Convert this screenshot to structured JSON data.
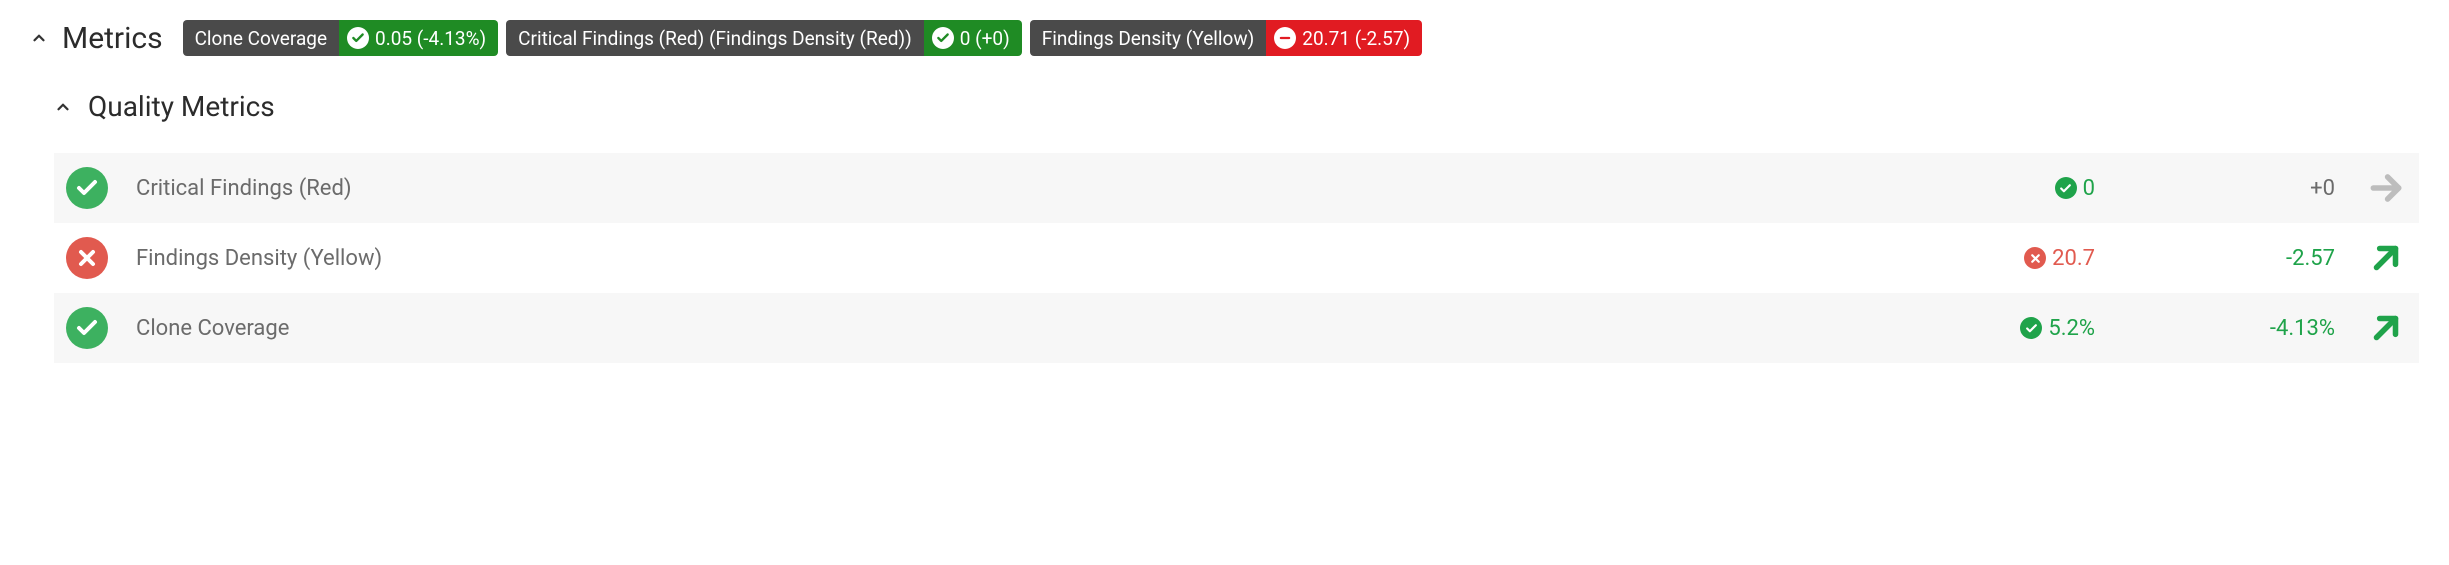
{
  "header": {
    "title": "Metrics"
  },
  "badges": [
    {
      "label": "Clone Coverage",
      "status": "ok",
      "color": "green",
      "value_text": "0.05 (-4.13%)"
    },
    {
      "label": "Critical Findings (Red) (Findings Density (Red))",
      "status": "ok",
      "color": "green",
      "value_text": "0 (+0)"
    },
    {
      "label": "Findings Density (Yellow)",
      "status": "fail",
      "color": "red",
      "value_text": "20.71 (-2.57)"
    }
  ],
  "quality": {
    "title": "Quality Metrics"
  },
  "rows": [
    {
      "status": "ok",
      "name": "Critical Findings (Red)",
      "value_status": "ok",
      "value": "0",
      "value_color": "green",
      "delta": "+0",
      "delta_color": "gray",
      "trend": "flat"
    },
    {
      "status": "fail",
      "name": "Findings Density (Yellow)",
      "value_status": "fail",
      "value": "20.7",
      "value_color": "red",
      "delta": "-2.57",
      "delta_color": "green",
      "trend": "up"
    },
    {
      "status": "ok",
      "name": "Clone Coverage",
      "value_status": "ok",
      "value": "5.2%",
      "value_color": "green",
      "delta": "-4.13%",
      "delta_color": "green",
      "trend": "up"
    }
  ]
}
